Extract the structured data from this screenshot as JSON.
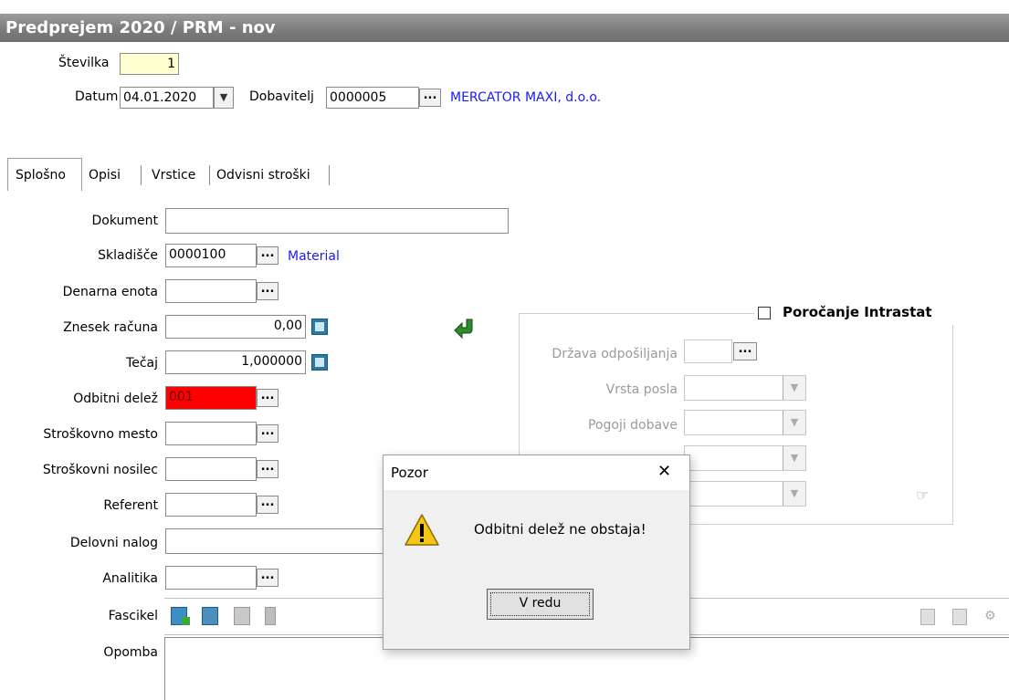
{
  "window": {
    "title": "Predprejem 2020 / PRM - nov"
  },
  "header": {
    "stevilka_label": "Številka",
    "stevilka_value": "1",
    "datum_label": "Datum",
    "datum_value": "04.01.2020",
    "dobavitelj_label": "Dobavitelj",
    "dobavitelj_value": "0000005",
    "dobavitelj_name": "MERCATOR MAXI, d.o.o.",
    "lookup_label": "..."
  },
  "tabs": [
    "Splošno",
    "Opisi",
    "Vrstice",
    "Odvisni stroški"
  ],
  "form": {
    "dokument_label": "Dokument",
    "dokument_value": "",
    "skladisce_label": "Skladišče",
    "skladisce_value": "0000100",
    "skladisce_name": "Material",
    "denarna_label": "Denarna enota",
    "denarna_value": "",
    "znesek_label": "Znesek računa",
    "znesek_value": "0,00",
    "tecaj_label": "Tečaj",
    "tecaj_value": "1,000000",
    "odbitni_label": "Odbitni delež",
    "odbitni_value": "001",
    "strmesto_label": "Stroškovno mesto",
    "strnosilec_label": "Stroškovni nosilec",
    "referent_label": "Referent",
    "delovni_label": "Delovni nalog",
    "analitika_label": "Analitika",
    "fascikel_label": "Fascikel",
    "opomba_label": "Opomba"
  },
  "intrastat": {
    "checkbox_label": "Poročanje Intrastat",
    "checked": false,
    "drzava_label": "Država odpošiljanja",
    "vrsta_label": "Vrsta posla",
    "pogoji_label": "Pogoji dobave"
  },
  "dialog": {
    "title": "Pozor",
    "message": "Odbitni delež ne obstaja!",
    "ok_label": "V redu",
    "close_glyph": "✕"
  },
  "colors": {
    "error_field": "#ff0000",
    "link": "#1a1aff",
    "titlebar": "#7d7d7d"
  }
}
